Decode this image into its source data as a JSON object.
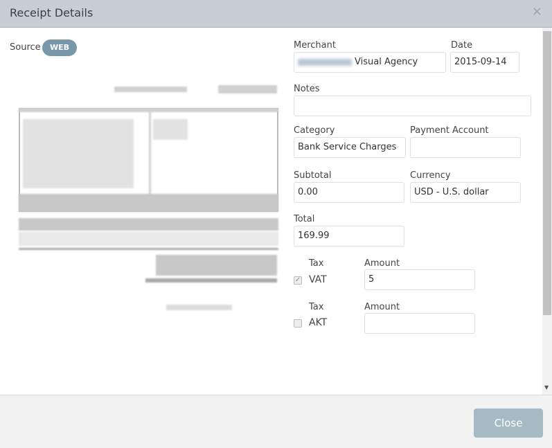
{
  "dialog": {
    "title": "Receipt Details",
    "close_icon": "×"
  },
  "source": {
    "label": "Source",
    "value": "WEB"
  },
  "form": {
    "merchant": {
      "label": "Merchant",
      "value": "Visual Agency"
    },
    "date": {
      "label": "Date",
      "value": "2015-09-14"
    },
    "notes": {
      "label": "Notes",
      "value": ""
    },
    "category": {
      "label": "Category",
      "value": "Bank Service Charges"
    },
    "payment_account": {
      "label": "Payment Account",
      "value": ""
    },
    "subtotal": {
      "label": "Subtotal",
      "value": "0.00"
    },
    "currency": {
      "label": "Currency",
      "value": "USD - U.S. dollar"
    },
    "total": {
      "label": "Total",
      "value": "169.99"
    },
    "taxes": [
      {
        "tax_label": "Tax",
        "amount_label": "Amount",
        "name": "VAT",
        "checked": true,
        "amount": "5"
      },
      {
        "tax_label": "Tax",
        "amount_label": "Amount",
        "name": "AKT",
        "checked": false,
        "amount": ""
      }
    ]
  },
  "footer": {
    "close_label": "Close"
  }
}
